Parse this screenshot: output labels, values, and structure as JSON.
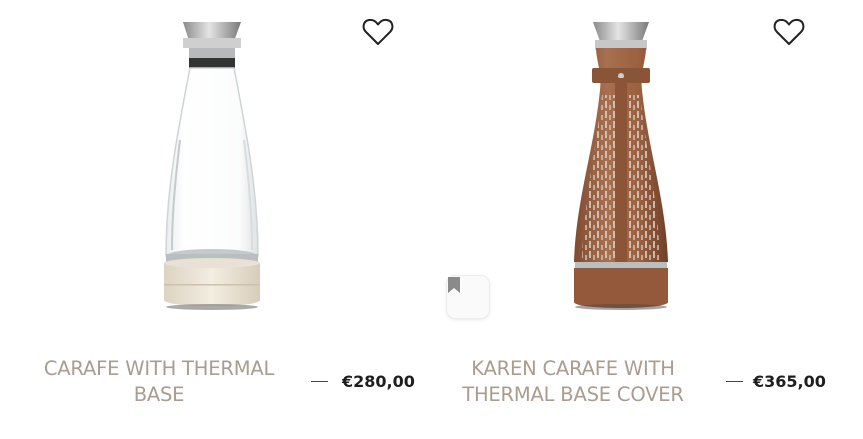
{
  "products": [
    {
      "name": "CARAFE WITH THERMAL BASE",
      "price": "€280,00",
      "icons": [
        "heart-outline-icon"
      ]
    },
    {
      "name": "KAREN CARAFE WITH THERMAL BASE COVER",
      "price": "€365,00",
      "icons": [
        "heart-outline-icon",
        "bookmark-icon"
      ]
    }
  ],
  "colors": {
    "title": "#aa9c8f",
    "price": "#1e1e1e",
    "leather": "#9a6040",
    "cream_base": "#ece4d4"
  }
}
